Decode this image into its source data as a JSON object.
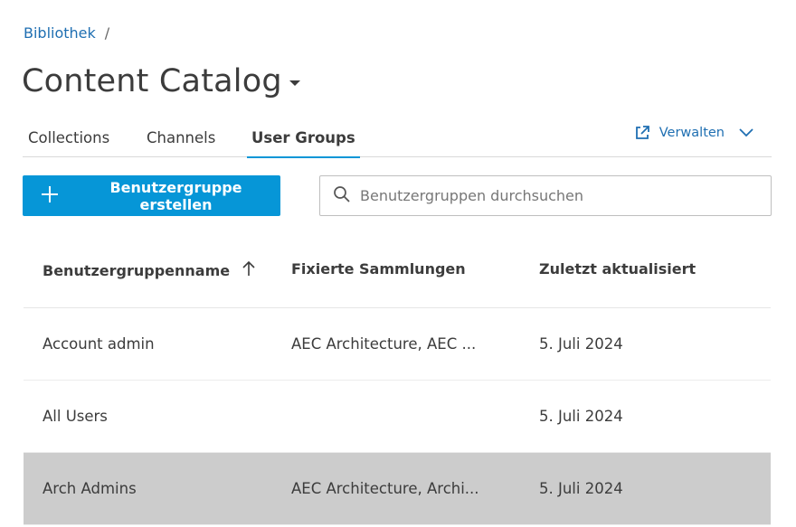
{
  "breadcrumb": {
    "link": "Bibliothek",
    "separator": "/"
  },
  "header": {
    "title": "Content Catalog"
  },
  "tabs": [
    {
      "label": "Collections",
      "active": false
    },
    {
      "label": "Channels",
      "active": false
    },
    {
      "label": "User Groups",
      "active": true
    }
  ],
  "manage": {
    "label": "Verwalten",
    "icon": "external-link-icon"
  },
  "create_button": {
    "label": "Benutzergruppe erstellen",
    "icon": "plus-icon"
  },
  "search": {
    "placeholder": "Benutzergruppen durchsuchen",
    "value": "",
    "icon": "search-icon"
  },
  "table": {
    "columns": [
      {
        "label": "Benutzergruppenname",
        "sort": "ascending"
      },
      {
        "label": "Fixierte Sammlungen"
      },
      {
        "label": "Zuletzt aktualisiert"
      }
    ],
    "rows": [
      {
        "name": "Account admin",
        "collections": "AEC Architecture, AEC ...",
        "updated": "5. Juli 2024",
        "selected": false
      },
      {
        "name": "All Users",
        "collections": "",
        "updated": "5. Juli 2024",
        "selected": false
      },
      {
        "name": "Arch Admins",
        "collections": "AEC Architecture, Archi...",
        "updated": "5. Juli 2024",
        "selected": true
      }
    ]
  },
  "colors": {
    "accent": "#0696d7",
    "link": "#1f6fb2",
    "selected_row": "#cccccc"
  }
}
